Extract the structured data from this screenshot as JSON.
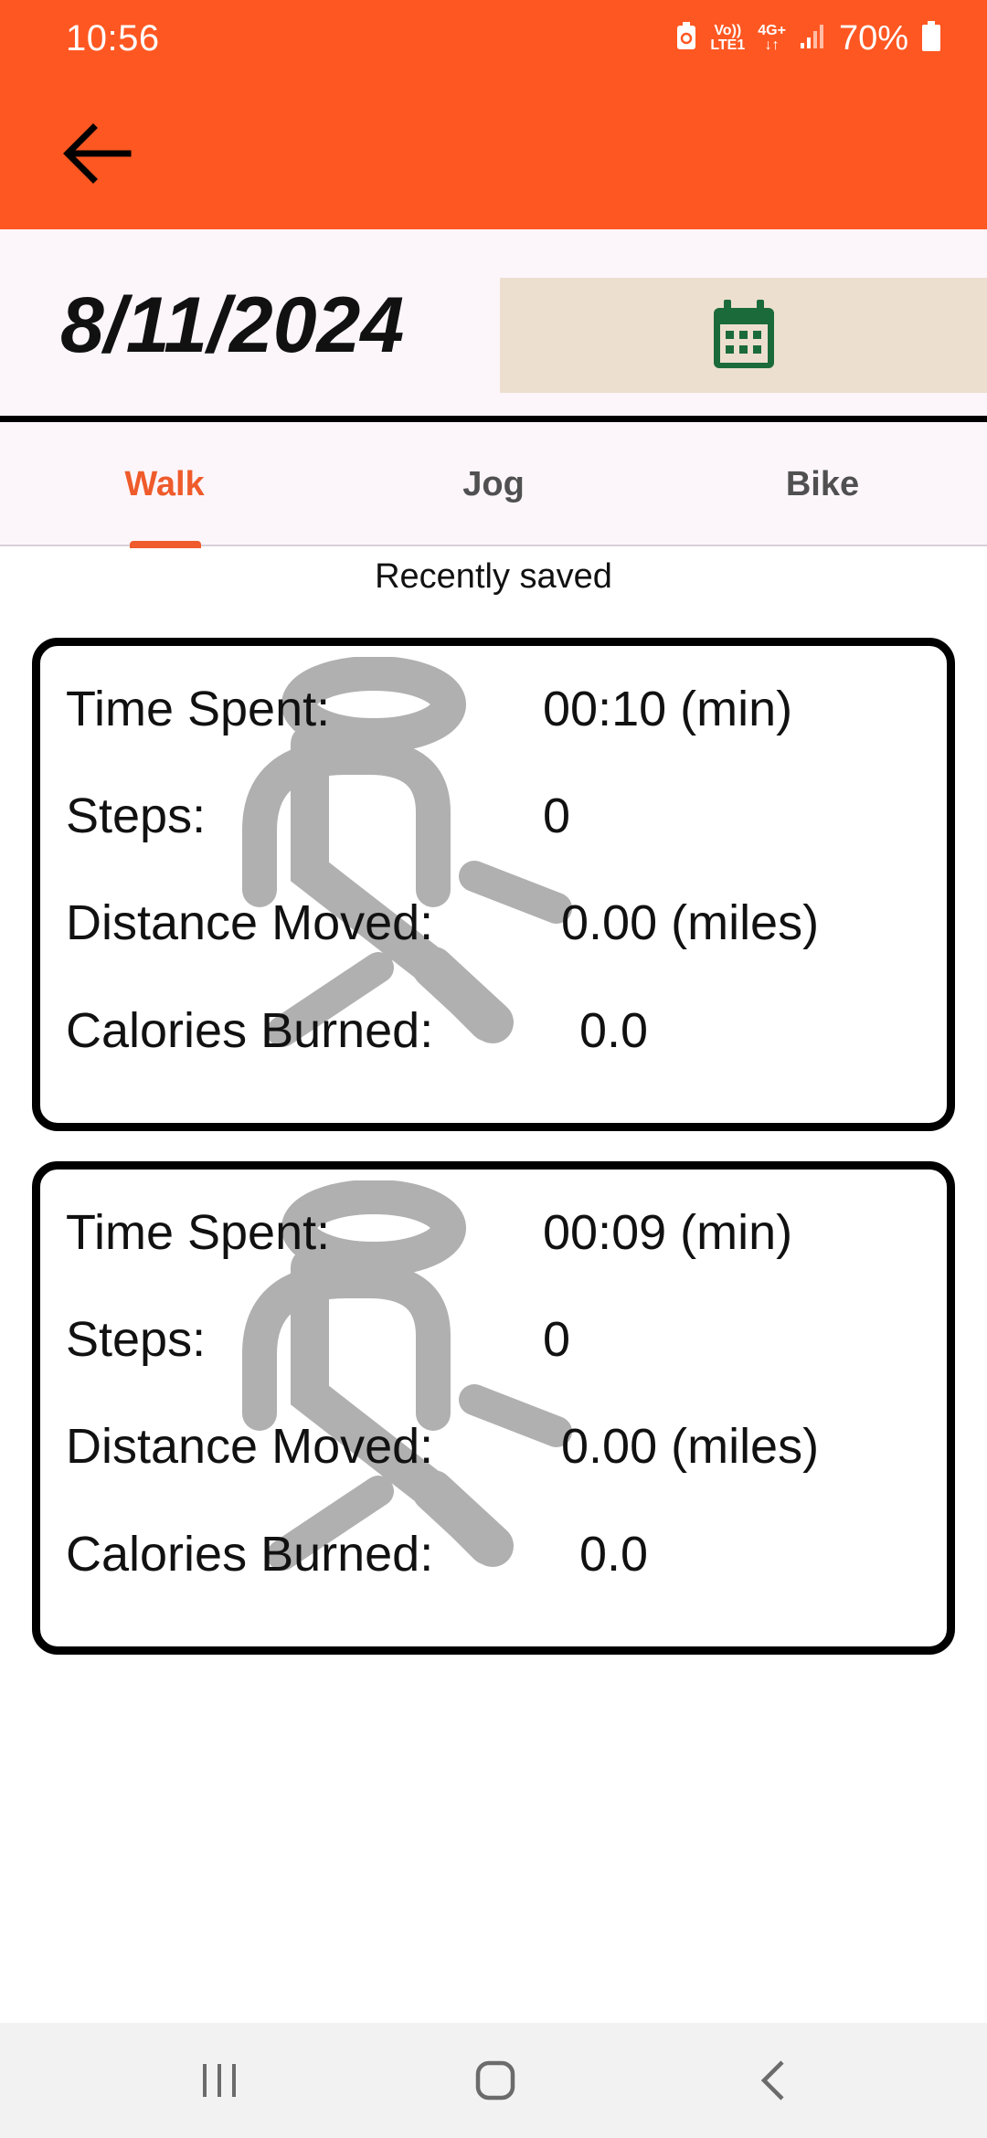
{
  "status": {
    "time": "10:56",
    "volte_top": "Vo))",
    "volte_bottom": "LTE1",
    "network": "4G+",
    "battery": "70%"
  },
  "header": {
    "back_icon": "arrow-left-icon"
  },
  "date_picker": {
    "date": "8/11/2024",
    "calendar_icon": "calendar-icon",
    "calendar_color": "#1b6b3a"
  },
  "tabs": [
    {
      "label": "Walk",
      "active": true
    },
    {
      "label": "Jog",
      "active": false
    },
    {
      "label": "Bike",
      "active": false
    }
  ],
  "accent_color": "#ff5722",
  "recent_label": "Recently saved",
  "records": [
    {
      "time_label": "Time Spent:",
      "time_value": "00:10 (min)",
      "steps_label": "Steps:",
      "steps_value": "0",
      "distance_label": "Distance Moved:",
      "distance_value": "0.00 (miles)",
      "calories_label": "Calories Burned:",
      "calories_value": "0.0",
      "background_icon": "walking-person-icon"
    },
    {
      "time_label": "Time Spent:",
      "time_value": "00:09 (min)",
      "steps_label": "Steps:",
      "steps_value": "0",
      "distance_label": "Distance Moved:",
      "distance_value": "0.00 (miles)",
      "calories_label": "Calories Burned:",
      "calories_value": "0.0",
      "background_icon": "walking-person-icon"
    }
  ],
  "nav": {
    "recents_icon": "recent-apps-icon",
    "home_icon": "home-icon",
    "back_icon": "nav-back-icon"
  }
}
